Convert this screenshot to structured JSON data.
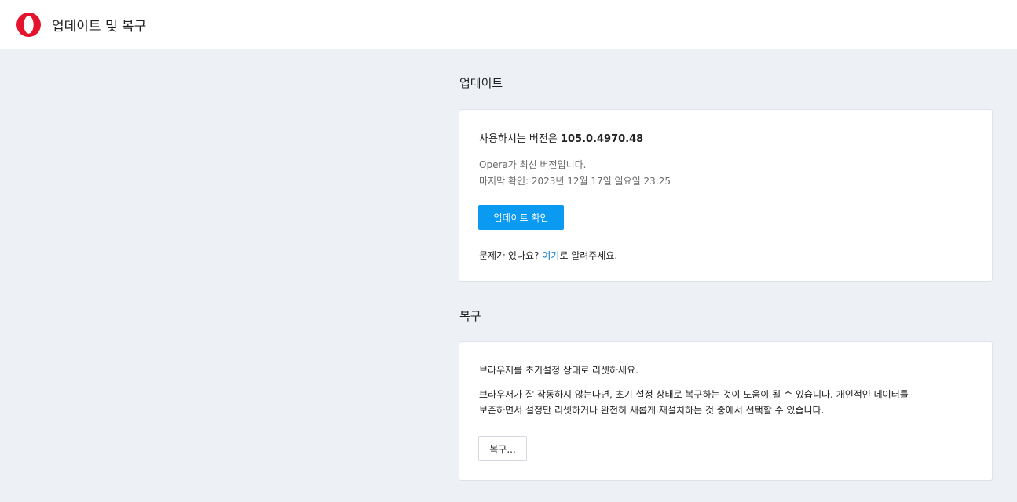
{
  "header": {
    "title": "업데이트 및 복구",
    "logo_icon": "opera-logo-icon",
    "logo_color": "#e3142c"
  },
  "update_section": {
    "title": "업데이트",
    "version_label": "사용하시는 버전은",
    "version_number": "105.0.4970.48",
    "status": "Opera가 최신 버전입니다.",
    "last_checked": "마지막 확인: 2023년 12월 17일 일요일 23:25",
    "check_button": "업데이트 확인",
    "problem_prefix": "문제가 있나요? ",
    "problem_link": "여기",
    "problem_suffix": "로 알려주세요."
  },
  "recovery_section": {
    "title": "복구",
    "heading": "브라우저를 초기설정 상태로 리셋하세요.",
    "description_line1": "브라우저가 잘 작동하지 않는다면, 초기 설정 상태로 복구하는 것이 도움이 될 수 있습니다. 개인적인 데이터를",
    "description_line2": "보존하면서 설정만 리셋하거나 완전히 새롭게 재설치하는 것 중에서 선택할 수 있습니다.",
    "recover_button": "복구..."
  },
  "colors": {
    "accent": "#0a9af2",
    "link": "#0a73c7",
    "background": "#edf1f5"
  }
}
